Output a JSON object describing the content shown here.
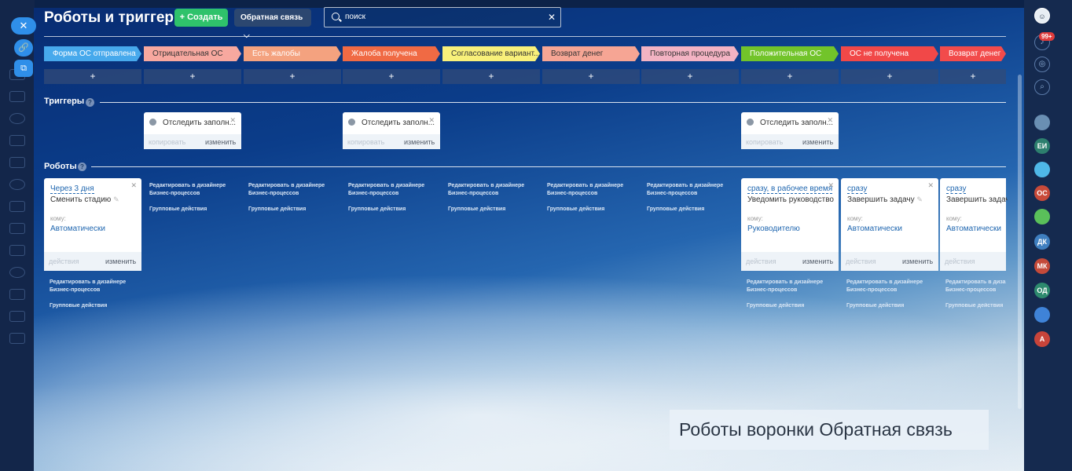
{
  "page": {
    "title": "Роботы и триггеры",
    "create_label": "Создать",
    "funnel_label": "Обратная связь",
    "search_placeholder": "поиск"
  },
  "colors": {
    "create": "#2fc26b",
    "link": "#2067b0"
  },
  "stages": [
    {
      "name": "Форма ОС отправлена",
      "color": "#47a9ec",
      "dark": false
    },
    {
      "name": "Отрицательная ОС",
      "color": "#f7a89f",
      "dark": true
    },
    {
      "name": "Есть жалобы",
      "color": "#f4a27f",
      "dark": false
    },
    {
      "name": "Жалоба получена",
      "color": "#f06a44",
      "dark": false
    },
    {
      "name": "Согласование вариант...",
      "color": "#f8f07a",
      "dark": true
    },
    {
      "name": "Возврат денег",
      "color": "#f6a594",
      "dark": true
    },
    {
      "name": "Повторная процедура",
      "color": "#f3b3c3",
      "dark": true
    },
    {
      "name": "Положительная ОС",
      "color": "#72c42a",
      "dark": false
    },
    {
      "name": "ОС не получена",
      "color": "#f14848",
      "dark": false
    },
    {
      "name": "Возврат денег",
      "color": "#f24b4b",
      "dark": false
    }
  ],
  "plus_label": "+",
  "triggers": {
    "label": "Триггеры",
    "help": "?",
    "cards": [
      {
        "name": "Отследить заполн...",
        "copy": "копировать",
        "edit": "изменить"
      },
      {
        "name": "Отследить заполн...",
        "copy": "копировать",
        "edit": "изменить"
      },
      {
        "name": "Отследить заполн...",
        "copy": "копировать",
        "edit": "изменить"
      }
    ]
  },
  "robots": {
    "label": "Роботы",
    "help": "?",
    "to_label": "кому:",
    "actions_label": "действия",
    "edit_label": "изменить",
    "cards": [
      {
        "when": "Через 3 дня",
        "action": "Сменить стадию",
        "to": "Автоматически"
      },
      {
        "when": "сразу, в рабочее время",
        "action": "Уведомить руководство",
        "to": "Руководителю"
      },
      {
        "when": "сразу",
        "action": "Завершить задачу",
        "to": "Автоматически"
      },
      {
        "when": "сразу",
        "action": "Завершить задачу",
        "to": "Автоматически"
      }
    ],
    "edit_designer_line1": "Редактировать в дизайнере",
    "edit_designer_line2": "Бизнес-процессов",
    "group_actions": "Групповые действия"
  },
  "right_sidebar": {
    "notifications_count": "99+",
    "avatars": [
      "ЕИ",
      "ОС",
      "ДК",
      "МК",
      "ОД",
      "А"
    ]
  },
  "caption": "Роботы воронки Обратная связь"
}
